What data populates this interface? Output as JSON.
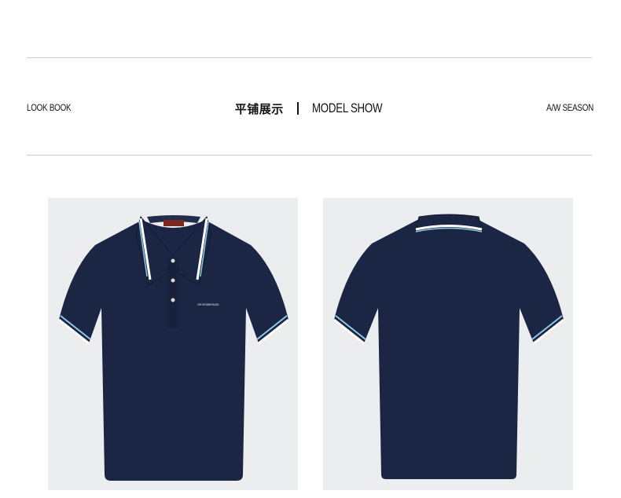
{
  "header": {
    "left_label": "LOOK BOOK",
    "center_zh": "平铺展示",
    "center_en": "MODEL SHOW",
    "right_label": "A/W SEASON"
  },
  "products": {
    "front": {
      "view": "front",
      "chest_logo": "SEVENBRAND"
    },
    "back": {
      "view": "back"
    }
  },
  "colors": {
    "shirt": "#1b2544",
    "trim_white": "#ffffff",
    "trim_blue": "#8ec9e6",
    "rule": "#c9c9c9",
    "photo_bg": "#ecedef"
  }
}
